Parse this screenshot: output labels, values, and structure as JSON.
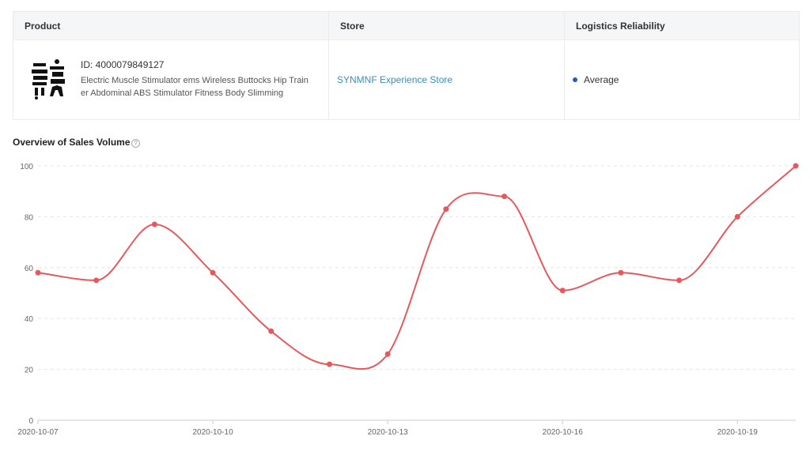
{
  "table": {
    "headers": {
      "product": "Product",
      "store": "Store",
      "logistics": "Logistics Reliability"
    },
    "row": {
      "product_id": "ID: 4000079849127",
      "product_title": "Electric Muscle Stimulator ems Wireless Buttocks Hip Trainer Abdominal ABS Stimulator Fitness Body Slimming",
      "store_name": "SYNMNF Experience Store",
      "logistics_status": "Average",
      "logistics_status_color": "#1e5dc9"
    }
  },
  "chart_section": {
    "title": "Overview of Sales Volume",
    "help_icon": "question-circle-icon"
  },
  "chart_data": {
    "type": "line",
    "x": [
      "2020-10-07",
      "2020-10-08",
      "2020-10-09",
      "2020-10-10",
      "2020-10-11",
      "2020-10-12",
      "2020-10-13",
      "2020-10-14",
      "2020-10-15",
      "2020-10-16",
      "2020-10-17",
      "2020-10-18",
      "2020-10-19",
      "2020-10-20"
    ],
    "x_tick_labels": [
      "2020-10-07",
      "2020-10-10",
      "2020-10-13",
      "2020-10-16",
      "2020-10-19"
    ],
    "series": [
      {
        "values": [
          58,
          55,
          77,
          58,
          35,
          22,
          26,
          83,
          88,
          51,
          58,
          55,
          80,
          100
        ]
      }
    ],
    "ylim": [
      0,
      100
    ],
    "yticks": [
      0,
      20,
      40,
      60,
      80,
      100
    ],
    "grid": true,
    "line_color": "#e8585b",
    "title": "",
    "xlabel": "",
    "ylabel": ""
  }
}
